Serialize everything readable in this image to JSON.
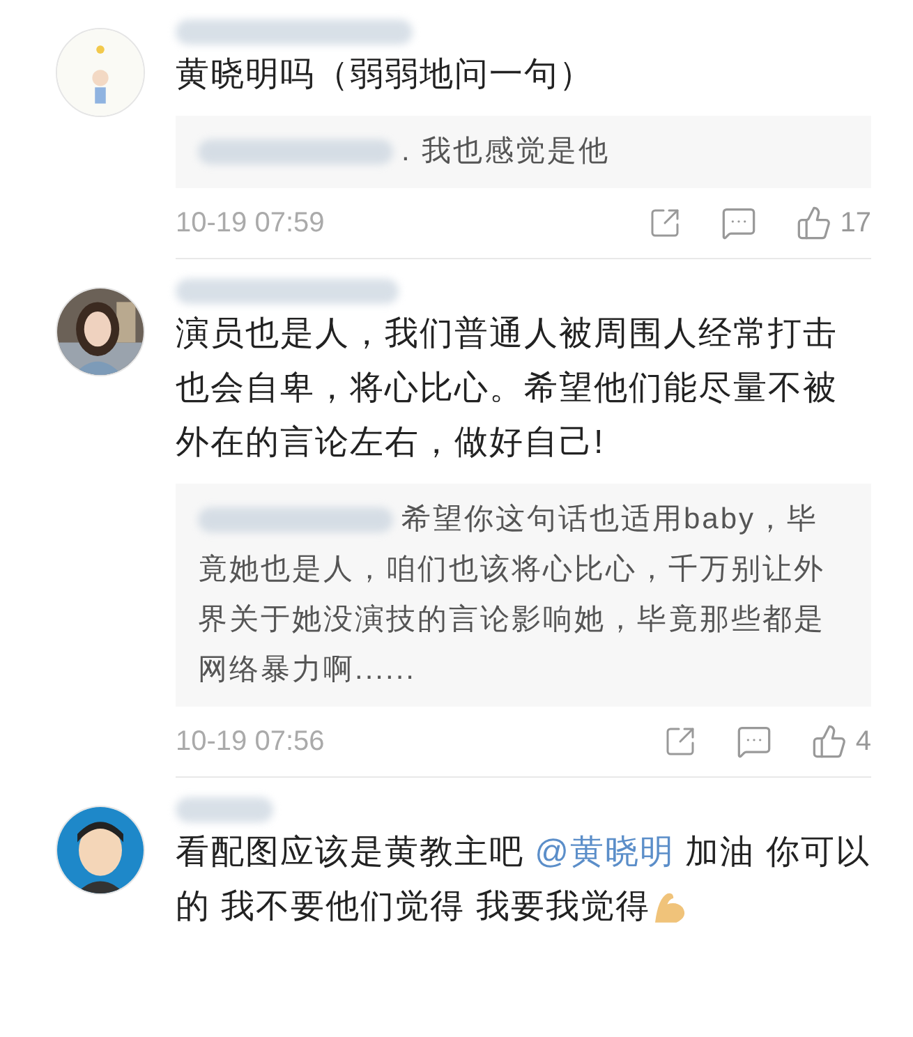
{
  "comments": [
    {
      "segments": [
        {
          "kind": "text",
          "text": "黄晓明吗（弱弱地问一句）"
        }
      ],
      "reply": {
        "text": ". 我也感觉是他"
      },
      "time": "10-19 07:59",
      "likes": "17"
    },
    {
      "segments": [
        {
          "kind": "text",
          "text": "演员也是人，我们普通人被周围人经常打击也会自卑，将心比心。希望他们能尽量不被外在的言论左右，做好自己!"
        }
      ],
      "reply": {
        "text": "希望你这句话也适用baby，毕竟她也是人，咱们也该将心比心，千万别让外界关于她没演技的言论影响她，毕竟那些都是网络暴力啊......"
      },
      "time": "10-19 07:56",
      "likes": "4"
    },
    {
      "segments": [
        {
          "kind": "text",
          "text": "看配图应该是黄教主吧 "
        },
        {
          "kind": "mention",
          "text": "@黄晓明"
        },
        {
          "kind": "text",
          "text": " 加油 你可以的 我不要他们觉得 我要我觉得"
        }
      ]
    }
  ]
}
